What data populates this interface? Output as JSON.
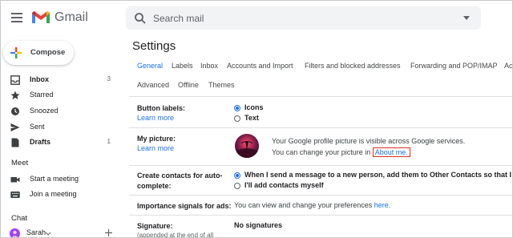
{
  "header": {
    "brand": "Gmail",
    "search_placeholder": "Search mail",
    "colors": {
      "red": "#ea4335",
      "blue": "#4285f4",
      "green": "#34a853",
      "yellow": "#fbbc04"
    }
  },
  "sidebar": {
    "compose_label": "Compose",
    "items": [
      {
        "label": "Inbox",
        "count": "3",
        "icon": "inbox-icon"
      },
      {
        "label": "Starred",
        "count": "",
        "icon": "star-icon"
      },
      {
        "label": "Snoozed",
        "count": "",
        "icon": "clock-icon"
      },
      {
        "label": "Sent",
        "count": "",
        "icon": "send-icon"
      },
      {
        "label": "Drafts",
        "count": "1",
        "icon": "draft-icon"
      }
    ],
    "meet_title": "Meet",
    "meet_items": [
      {
        "label": "Start a meeting",
        "icon": "video-icon"
      },
      {
        "label": "Join a meeting",
        "icon": "keyboard-icon"
      }
    ],
    "chat_title": "Chat",
    "chat_user": "Sarah"
  },
  "main": {
    "title": "Settings",
    "tabs_row1": [
      "General",
      "Labels",
      "Inbox",
      "Accounts and Import",
      "Filters and blocked addresses",
      "Forwarding and POP/IMAP",
      "Ac"
    ],
    "tabs_row2": [
      "Advanced",
      "Offline",
      "Themes"
    ],
    "active_tab": "General",
    "button_labels": {
      "label": "Button labels:",
      "learn_more": "Learn more",
      "opt_icons": "Icons",
      "opt_text": "Text"
    },
    "my_picture": {
      "label": "My picture:",
      "learn_more": "Learn more",
      "line1": "Your Google profile picture is visible across Google services.",
      "line2_prefix": "You can change your picture in ",
      "about_link": "About me."
    },
    "create_contacts": {
      "label_line1": "Create contacts for auto-",
      "label_line2": "complete:",
      "opt1": "When I send a message to a new person, add them to Other Contacts so that I can au",
      "opt2": "I'll add contacts myself"
    },
    "importance": {
      "label": "Importance signals for ads:",
      "text": "You can view and change your preferences ",
      "link": "here."
    },
    "signature": {
      "label": "Signature:",
      "note": "(appended at the end of all",
      "value": "No signatures"
    }
  }
}
